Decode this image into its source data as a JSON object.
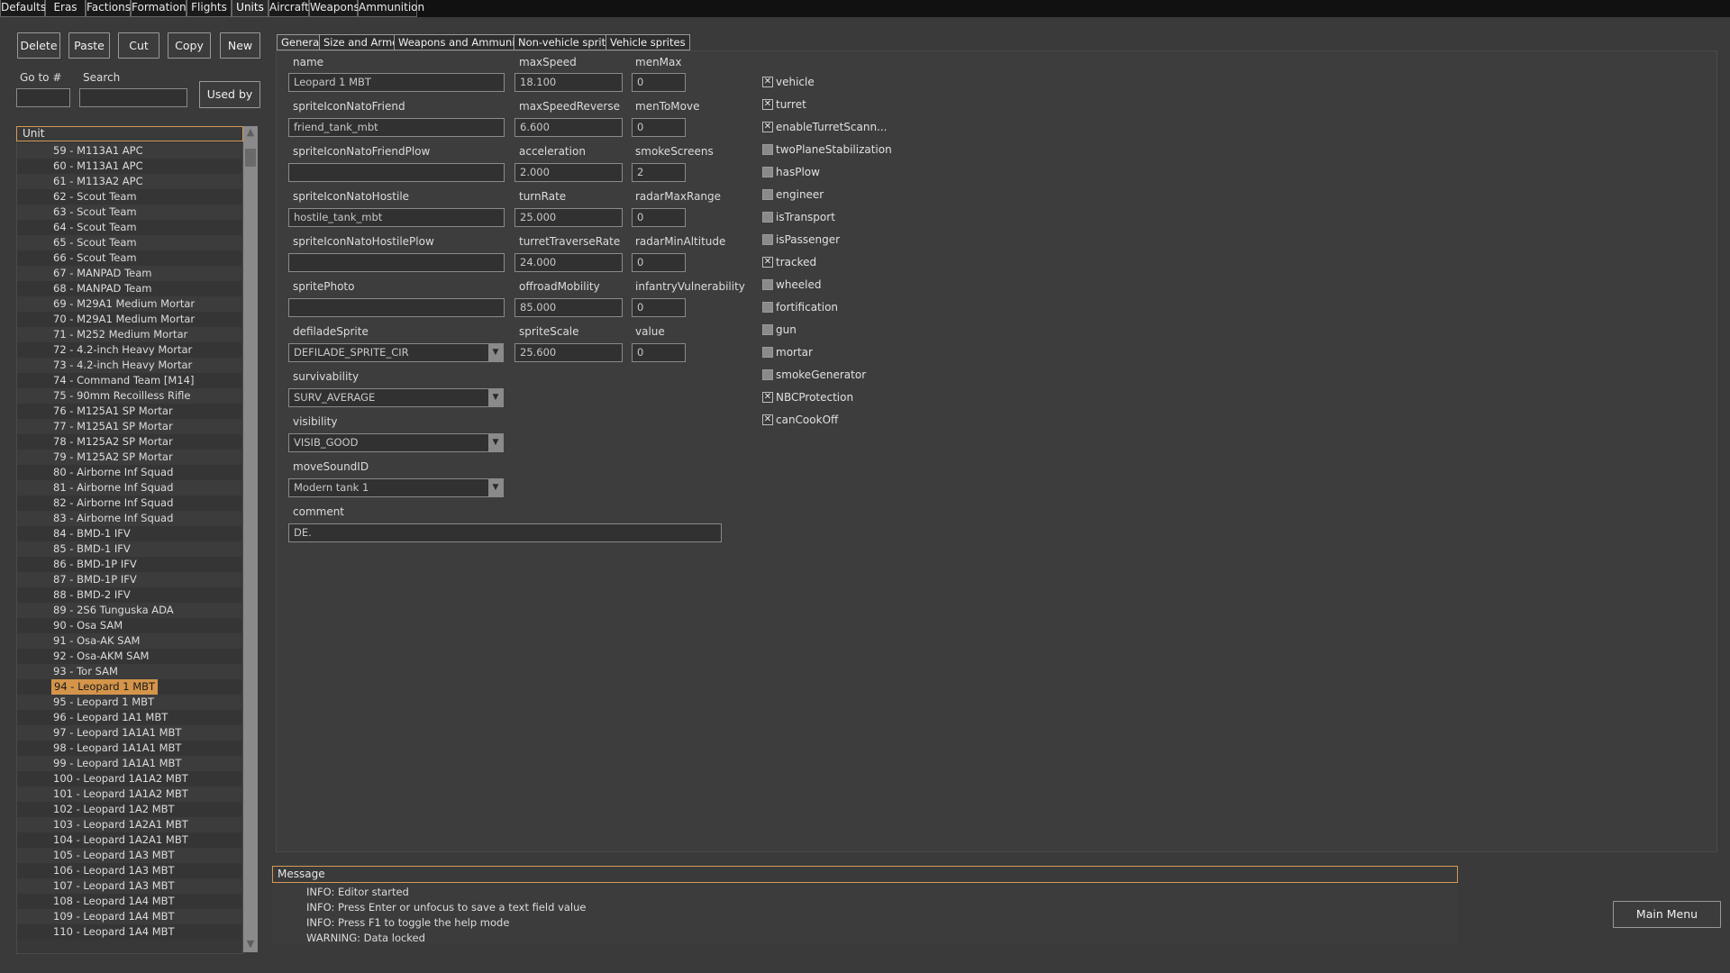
{
  "top_menu": [
    "Defaults",
    "Eras",
    "Factions",
    "Formations",
    "Flights",
    "Units",
    "Aircraft",
    "Weapons",
    "Ammunition"
  ],
  "toolbar": {
    "delete": "Delete",
    "paste": "Paste",
    "cut": "Cut",
    "copy": "Copy",
    "new": "New",
    "goto_label": "Go to #",
    "search_label": "Search",
    "goto_value": "",
    "search_value": "",
    "used_by": "Used by"
  },
  "unit_list": {
    "header": "Unit",
    "selected_index": 35,
    "items": [
      "59 - M113A1 APC",
      "60 - M113A1 APC",
      "61 - M113A2 APC",
      "62 - Scout Team",
      "63 - Scout Team",
      "64 - Scout Team",
      "65 - Scout Team",
      "66 - Scout Team",
      "67 - MANPAD Team",
      "68 - MANPAD Team",
      "69 - M29A1 Medium Mortar",
      "70 - M29A1 Medium Mortar",
      "71 - M252 Medium Mortar",
      "72 - 4.2-inch Heavy Mortar",
      "73 - 4.2-inch Heavy Mortar",
      "74 - Command Team [M14]",
      "75 - 90mm Recoilless Rifle",
      "76 - M125A1 SP Mortar",
      "77 - M125A1 SP Mortar",
      "78 - M125A2 SP Mortar",
      "79 - M125A2 SP Mortar",
      "80 - Airborne Inf Squad",
      "81 - Airborne Inf Squad",
      "82 - Airborne Inf Squad",
      "83 - Airborne Inf Squad",
      "84 - BMD-1 IFV",
      "85 - BMD-1 IFV",
      "86 - BMD-1P IFV",
      "87 - BMD-1P IFV",
      "88 - BMD-2 IFV",
      "89 - 2S6 Tunguska ADA",
      "90 - Osa SAM",
      "91 - Osa-AK SAM",
      "92 - Osa-AKM SAM",
      "93 - Tor SAM",
      "94 - Leopard 1 MBT",
      "95 - Leopard 1 MBT",
      "96 - Leopard 1A1 MBT",
      "97 - Leopard 1A1A1 MBT",
      "98 - Leopard 1A1A1 MBT",
      "99 - Leopard 1A1A1 MBT",
      "100 - Leopard 1A1A2 MBT",
      "101 - Leopard 1A1A2 MBT",
      "102 - Leopard 1A2 MBT",
      "103 - Leopard 1A2A1 MBT",
      "104 - Leopard 1A2A1 MBT",
      "105 - Leopard 1A3 MBT",
      "106 - Leopard 1A3 MBT",
      "107 - Leopard 1A3 MBT",
      "108 - Leopard 1A4 MBT",
      "109 - Leopard 1A4 MBT",
      "110 - Leopard 1A4 MBT"
    ]
  },
  "tabs": [
    "General",
    "Size and Armor",
    "Weapons and Ammunition",
    "Non-vehicle sprites",
    "Vehicle sprites"
  ],
  "fields": {
    "name": {
      "label": "name",
      "value": "Leopard 1 MBT"
    },
    "spriteIconNatoFriend": {
      "label": "spriteIconNatoFriend",
      "value": "friend_tank_mbt"
    },
    "spriteIconNatoFriendPlow": {
      "label": "spriteIconNatoFriendPlow",
      "value": ""
    },
    "spriteIconNatoHostile": {
      "label": "spriteIconNatoHostile",
      "value": "hostile_tank_mbt"
    },
    "spriteIconNatoHostilePlow": {
      "label": "spriteIconNatoHostilePlow",
      "value": ""
    },
    "spritePhoto": {
      "label": "spritePhoto",
      "value": ""
    },
    "defiladeSprite": {
      "label": "defiladeSprite",
      "value": "DEFILADE_SPRITE_CIR"
    },
    "survivability": {
      "label": "survivability",
      "value": "SURV_AVERAGE"
    },
    "visibility": {
      "label": "visibility",
      "value": "VISIB_GOOD"
    },
    "moveSoundID": {
      "label": "moveSoundID",
      "value": "Modern tank 1"
    },
    "comment": {
      "label": "comment",
      "value": "DE."
    },
    "maxSpeed": {
      "label": "maxSpeed",
      "value": "18.100"
    },
    "maxSpeedReverse": {
      "label": "maxSpeedReverse",
      "value": "6.600"
    },
    "acceleration": {
      "label": "acceleration",
      "value": "2.000"
    },
    "turnRate": {
      "label": "turnRate",
      "value": "25.000"
    },
    "turretTraverseRate": {
      "label": "turretTraverseRate",
      "value": "24.000"
    },
    "offroadMobility": {
      "label": "offroadMobility",
      "value": "85.000"
    },
    "spriteScale": {
      "label": "spriteScale",
      "value": "25.600"
    },
    "menMax": {
      "label": "menMax",
      "value": "0"
    },
    "menToMove": {
      "label": "menToMove",
      "value": "0"
    },
    "smokeScreens": {
      "label": "smokeScreens",
      "value": "2"
    },
    "radarMaxRange": {
      "label": "radarMaxRange",
      "value": "0"
    },
    "radarMinAltitude": {
      "label": "radarMinAltitude",
      "value": "0"
    },
    "infantryVulnerability": {
      "label": "infantryVulnerability",
      "value": "0"
    },
    "value": {
      "label": "value",
      "value": "0"
    }
  },
  "checkboxes": [
    {
      "label": "vehicle",
      "checked": true
    },
    {
      "label": "turret",
      "checked": true
    },
    {
      "label": "enableTurretScann...",
      "checked": true
    },
    {
      "label": "twoPlaneStabilization",
      "checked": false
    },
    {
      "label": "hasPlow",
      "checked": false
    },
    {
      "label": "engineer",
      "checked": false
    },
    {
      "label": "isTransport",
      "checked": false
    },
    {
      "label": "isPassenger",
      "checked": false
    },
    {
      "label": "tracked",
      "checked": true
    },
    {
      "label": "wheeled",
      "checked": false
    },
    {
      "label": "fortification",
      "checked": false
    },
    {
      "label": "gun",
      "checked": false
    },
    {
      "label": "mortar",
      "checked": false
    },
    {
      "label": "smokeGenerator",
      "checked": false
    },
    {
      "label": "NBCProtection",
      "checked": true
    },
    {
      "label": "canCookOff",
      "checked": true
    }
  ],
  "messages": {
    "header": "Message",
    "lines": [
      "INFO: Editor started",
      "INFO: Press Enter or unfocus to save a text field value",
      "INFO: Press F1 to toggle the help mode",
      "WARNING: Data locked"
    ]
  },
  "main_menu_button": "Main Menu",
  "check_mark": "✕"
}
